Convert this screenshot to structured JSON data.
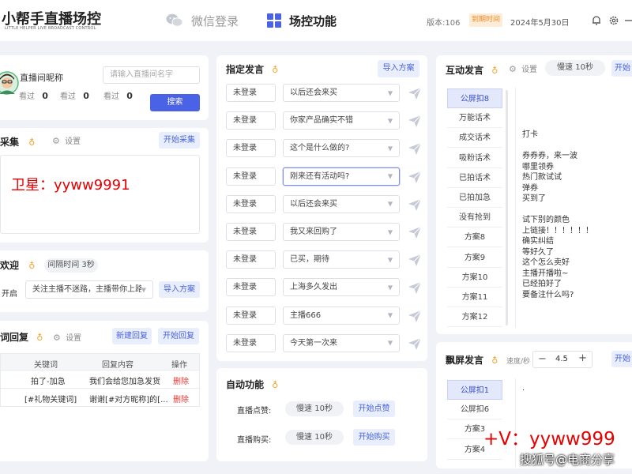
{
  "header": {
    "logo_title": "小帮手直播场控",
    "logo_subtitle": "LITTLE HELPER LIVE BROADCAST CONTROL",
    "nav_wechat_login": "微信登录",
    "nav_control": "场控功能",
    "version": "版本:106",
    "expire_badge": "到期时间",
    "expire_date": "2024年5月30日"
  },
  "profile": {
    "nickname": "直播间昵称",
    "room_input_placeholder": "请输入直播间名字",
    "stats": [
      {
        "label": "看过",
        "value": "0"
      },
      {
        "label": "看过",
        "value": "0"
      },
      {
        "label": "看过",
        "value": "0"
      }
    ],
    "search_button": "搜索"
  },
  "collect": {
    "title": "采集",
    "settings": "设置",
    "start_button": "开始采集",
    "overlay_text": "卫星：yyww9991"
  },
  "welcome": {
    "title": "欢迎",
    "interval_pill": "间隔时间 3秒",
    "enable_label": "开启",
    "message_value": "关注主播不迷路，主播带你上路",
    "import_button": "导入方案"
  },
  "keyword_reply": {
    "title": "词回复",
    "settings": "设置",
    "new_button": "新建回复",
    "start_button": "开始回复",
    "columns": [
      "",
      "关键词",
      "回复内容",
      "操作"
    ],
    "rows": [
      {
        "index": "",
        "keyword": "拍了-加急",
        "reply": "我们会给您加急发货",
        "action": "删除"
      },
      {
        "index": "",
        "keyword": "[#礼物关键词]",
        "reply": "谢谢[#对方昵称]的[...",
        "action": "删除"
      }
    ]
  },
  "designated": {
    "title": "指定发言",
    "import_button": "导入方案",
    "rows": [
      {
        "account": "未登录",
        "message": "以后还会来买"
      },
      {
        "account": "未登录",
        "message": "你家产品确实不错"
      },
      {
        "account": "未登录",
        "message": "这个是什么做的?"
      },
      {
        "account": "未登录",
        "message": "刚来还有活动吗?"
      },
      {
        "account": "未登录",
        "message": "以后还会来买"
      },
      {
        "account": "未登录",
        "message": "我又来回购了"
      },
      {
        "account": "未登录",
        "message": "已买，期待"
      },
      {
        "account": "未登录",
        "message": "上海多久发出"
      },
      {
        "account": "未登录",
        "message": "主播666"
      },
      {
        "account": "未登录",
        "message": "今天第一次来"
      }
    ]
  },
  "auto": {
    "title": "自动功能",
    "like_label": "直播点赞:",
    "like_speed": "慢速 10秒",
    "like_button": "开始点赞",
    "buy_label": "直播购买:",
    "buy_speed": "慢速 10秒",
    "buy_button": "开始购买"
  },
  "interactive": {
    "title": "互动发言",
    "settings": "设置",
    "speed_pill": "慢速 10秒",
    "start_button": "开始",
    "tabs": [
      "公屏扣8",
      "万能话术",
      "成交话术",
      "吸粉话术",
      "已拍话术",
      "已拍加急",
      "没有抢到",
      "方案8",
      "方案9",
      "方案10",
      "方案11",
      "方案12"
    ],
    "lines": [
      "",
      "",
      "",
      "",
      "打卡",
      "",
      "券券券，来一波",
      "哪里领券",
      "热门款试试",
      "弹券",
      "买到了",
      "",
      "试下别的颜色",
      "上链接！！！！！！",
      "确实纠结",
      "等好久了",
      "这个怎么卖好",
      "主播开播啦~",
      "已经拍好了",
      "要备注什么吗?"
    ]
  },
  "barrage": {
    "title": "飘屏发言",
    "speed_label": "速度/秒",
    "speed_value": "4.5",
    "start_button": "开始",
    "tabs": [
      "公屏扣1",
      "公屏扣6",
      "方案3",
      "方案4"
    ],
    "text_value": "."
  },
  "watermarks": {
    "wechat": "+V：yyww999",
    "source": "搜狐号@电商分享"
  },
  "colors": {
    "accent": "#4a62e6",
    "warning": "#f4a020",
    "danger": "#e53935",
    "overlay_red": "#e60000"
  }
}
